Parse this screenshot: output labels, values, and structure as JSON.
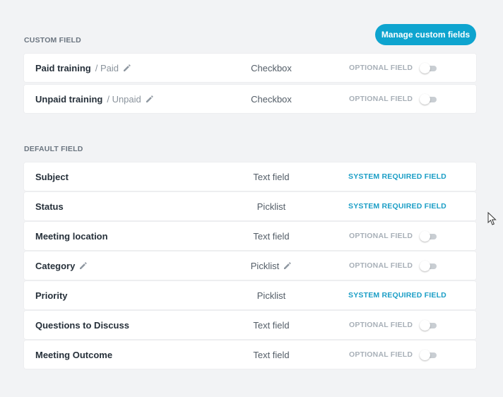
{
  "custom_section": {
    "label": "CUSTOM FIELD",
    "manage_button": "Manage custom fields",
    "rows": [
      {
        "name": "Paid training",
        "sub": "/ Paid",
        "type": "Checkbox",
        "status": "OPTIONAL FIELD",
        "editable": true
      },
      {
        "name": "Unpaid training",
        "sub": "/ Unpaid",
        "type": "Checkbox",
        "status": "OPTIONAL FIELD",
        "editable": true
      }
    ]
  },
  "default_section": {
    "label": "DEFAULT FIELD",
    "rows": [
      {
        "name": "Subject",
        "type": "Text field",
        "status": "SYSTEM REQUIRED FIELD",
        "kind": "system"
      },
      {
        "name": "Status",
        "type": "Picklist",
        "status": "SYSTEM REQUIRED FIELD",
        "kind": "system"
      },
      {
        "name": "Meeting location",
        "type": "Text field",
        "status": "OPTIONAL FIELD",
        "kind": "optional"
      },
      {
        "name": "Category",
        "type": "Picklist",
        "status": "OPTIONAL FIELD",
        "kind": "optional",
        "editable": true
      },
      {
        "name": "Priority",
        "type": "Picklist",
        "status": "SYSTEM REQUIRED FIELD",
        "kind": "system"
      },
      {
        "name": "Questions to Discuss",
        "type": "Text field",
        "status": "OPTIONAL FIELD",
        "kind": "optional"
      },
      {
        "name": "Meeting Outcome",
        "type": "Text field",
        "status": "OPTIONAL FIELD",
        "kind": "optional"
      }
    ]
  },
  "colors": {
    "accent": "#0ea4cf",
    "system_status": "#1b9ec6",
    "optional_status": "#a8b0b8",
    "background": "#f2f3f5"
  },
  "icons": {
    "edit": "pencil-icon",
    "toggle": "toggle-switch",
    "cursor": "mouse-pointer-icon"
  }
}
